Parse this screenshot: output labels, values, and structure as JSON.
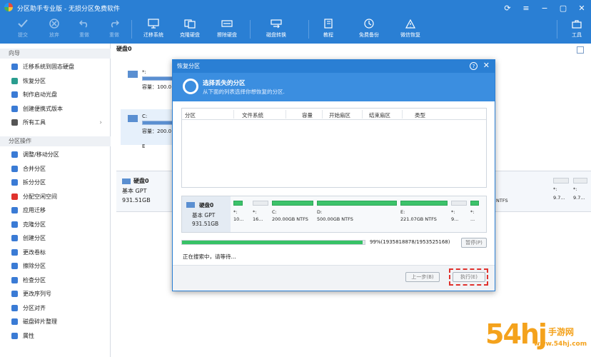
{
  "app": {
    "title": "分区助手专业版 - 无损分区免费软件"
  },
  "toolbar": {
    "commit": "提交",
    "discard": "放弃",
    "redo": "重做",
    "undo": "重做",
    "migrate_system": "迁移系统",
    "clone_disk": "克隆硬盘",
    "wipe_disk": "擦除硬盘",
    "disk_convert": "磁盘转换",
    "tutorial": "教程",
    "free_backup": "免费备份",
    "wechat_restore": "微信恢复",
    "tools": "工具"
  },
  "sidebar": {
    "wizard_title": "向导",
    "wizard_items": [
      {
        "label": "迁移系统到固态硬盘",
        "icon": "migrate-ssd-icon",
        "color": "#3a7bd5"
      },
      {
        "label": "恢复分区",
        "icon": "recover-partition-icon",
        "color": "#2a9d8f"
      },
      {
        "label": "制作启动光盘",
        "icon": "boot-disc-icon",
        "color": "#3a7bd5"
      },
      {
        "label": "创建便携式版本",
        "icon": "portable-icon",
        "color": "#3a7bd5"
      },
      {
        "label": "所有工具",
        "icon": "all-tools-icon",
        "color": "#555555"
      }
    ],
    "ops_title": "分区操作",
    "ops_items": [
      {
        "label": "调整/移动分区",
        "icon": "resize-icon",
        "color": "#3a7bd5"
      },
      {
        "label": "合并分区",
        "icon": "merge-icon",
        "color": "#3a7bd5"
      },
      {
        "label": "拆分分区",
        "icon": "split-icon",
        "color": "#3a7bd5"
      },
      {
        "label": "分配空闲空间",
        "icon": "allocate-icon",
        "color": "#e0322d"
      },
      {
        "label": "应用迁移",
        "icon": "app-migrate-icon",
        "color": "#3a7bd5"
      },
      {
        "label": "克隆分区",
        "icon": "clone-partition-icon",
        "color": "#3a7bd5"
      },
      {
        "label": "创建分区",
        "icon": "create-partition-icon",
        "color": "#3a7bd5"
      },
      {
        "label": "更改卷标",
        "icon": "label-icon",
        "color": "#3a7bd5"
      },
      {
        "label": "擦除分区",
        "icon": "wipe-partition-icon",
        "color": "#3a7bd5"
      },
      {
        "label": "检查分区",
        "icon": "check-partition-icon",
        "color": "#3a7bd5"
      },
      {
        "label": "更改序列号",
        "icon": "serial-icon",
        "color": "#3a7bd5"
      },
      {
        "label": "分区对齐",
        "icon": "align-icon",
        "color": "#3a7bd5"
      },
      {
        "label": "磁盘碎片整理",
        "icon": "defrag-icon",
        "color": "#3a7bd5"
      },
      {
        "label": "属性",
        "icon": "info-icon",
        "color": "#3a7bd5"
      }
    ]
  },
  "main": {
    "disk_header": "硬盘0",
    "cards": [
      {
        "name": "*:",
        "cap": "容量：100.0"
      },
      {
        "name": "C:",
        "cap": "容量：200.0"
      },
      {
        "name": "E",
        "cap": ""
      }
    ],
    "strip": {
      "title": "硬盘0",
      "type": "基本 GPT",
      "size": "931.51GB",
      "right": [
        {
          "label": "*:",
          "size": "9.7..."
        },
        {
          "label": "*:",
          "size": "9.7..."
        }
      ],
      "ntfs_tail": "NTFS"
    }
  },
  "dialog": {
    "title": "恢复分区",
    "head_title": "选择丢失的分区",
    "head_sub": "从下面的列表选择你想恢复的分区.",
    "columns": [
      "分区",
      "文件系统",
      "容量",
      "开始扇区",
      "结束扇区",
      "类型"
    ],
    "mini": {
      "title": "硬盘0",
      "type": "基本 GPT",
      "size": "931.51GB",
      "segments": [
        {
          "name": "*:",
          "size": "10...",
          "filled": true
        },
        {
          "name": "*:",
          "size": "16...",
          "filled": false
        },
        {
          "name": "C:",
          "size": "200.00GB NTFS",
          "filled": true
        },
        {
          "name": "D:",
          "size": "500.00GB NTFS",
          "filled": true
        },
        {
          "name": "E:",
          "size": "221.07GB NTFS",
          "filled": true
        },
        {
          "name": "*:",
          "size": "9...",
          "filled": false
        },
        {
          "name": "*:",
          "size": "...",
          "filled": true
        }
      ]
    },
    "progress_pct": 0.99,
    "progress_text": "99%(1935818878/1953525168)",
    "pause": "暂停(P)",
    "status": "正在搜索中，请等待...",
    "prev": "上一步(B)",
    "execute": "执行(E)"
  },
  "watermark": {
    "big": "54hj",
    "text": "手游网",
    "url": "www.54hj.com"
  },
  "colors": {
    "accent": "#2a7fd4",
    "progress": "#37c266",
    "highlight": "#e0322d",
    "watermark": "#f4a21c"
  }
}
